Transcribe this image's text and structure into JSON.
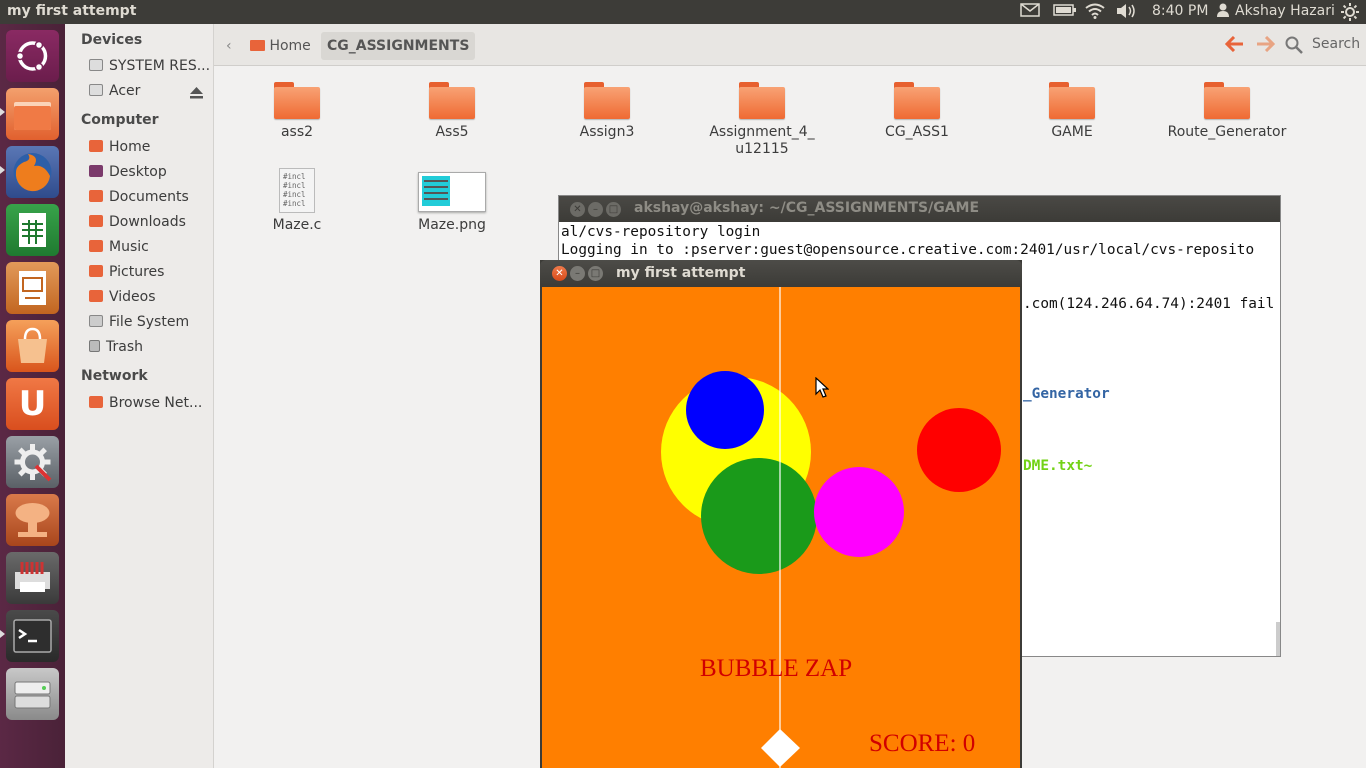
{
  "top_panel": {
    "window_title": "my first attempt",
    "time": "8:40 PM",
    "user": "Akshay Hazari",
    "indicators": [
      "mail-icon",
      "battery-icon",
      "wifi-icon",
      "volume-icon",
      "gear-icon"
    ]
  },
  "launcher": {
    "items": [
      "ubuntu-dash",
      "files",
      "firefox",
      "libreoffice-calc",
      "libreoffice-impress",
      "software-center",
      "ubuntu-one",
      "system-settings",
      "mushroom-app",
      "printer-app",
      "terminal",
      "removable-drive"
    ]
  },
  "sidebar": {
    "sections": [
      {
        "title": "Devices",
        "items": [
          "SYSTEM RES...",
          "Acer"
        ]
      },
      {
        "title": "Computer",
        "items": [
          "Home",
          "Desktop",
          "Documents",
          "Downloads",
          "Music",
          "Pictures",
          "Videos",
          "File System",
          "Trash"
        ]
      },
      {
        "title": "Network",
        "items": [
          "Browse Net..."
        ]
      }
    ]
  },
  "toolbar": {
    "crumbs": [
      "Home",
      "CG_ASSIGNMENTS"
    ],
    "search_label": "Search"
  },
  "files": [
    {
      "name": "ass2",
      "type": "folder"
    },
    {
      "name": "Ass5",
      "type": "folder"
    },
    {
      "name": "Assign3",
      "type": "folder"
    },
    {
      "name": "Assignment_4_\nu12115",
      "type": "folder"
    },
    {
      "name": "CG_ASS1",
      "type": "folder"
    },
    {
      "name": "GAME",
      "type": "folder"
    },
    {
      "name": "Route_Generator",
      "type": "folder"
    },
    {
      "name": "Maze.c",
      "type": "text",
      "preview": "#incl\n#incl\n#incl\n#incl"
    },
    {
      "name": "Maze.png",
      "type": "image"
    }
  ],
  "terminal": {
    "title": "akshay@akshay: ~/CG_ASSIGNMENTS/GAME",
    "lines": [
      "al/cvs-repository login",
      "Logging in to :pserver:guest@opensource.creative.com:2401/usr/local/cvs-reposito",
      ".com(124.246.64.74):2401 fail",
      "_Generator",
      "DME.txt~"
    ]
  },
  "game": {
    "title": "my first attempt",
    "heading": "BUBBLE ZAP",
    "score_label": "SCORE: 0",
    "colors": {
      "background": "#ff7f00",
      "yellow": "#ffff00",
      "blue": "#0000ff",
      "green": "#1a9a1a",
      "magenta": "#ff00ff",
      "red": "#ff0000",
      "text": "#d10000"
    }
  }
}
